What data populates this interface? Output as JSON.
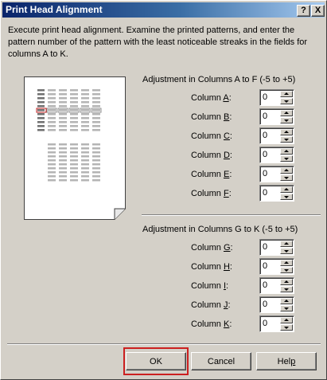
{
  "window": {
    "title": "Print Head Alignment",
    "help_glyph": "?",
    "close_glyph": "X"
  },
  "instructions": "Execute print head alignment. Examine the printed patterns, and enter the pattern number of the pattern with the least noticeable streaks in the fields for columns A to K.",
  "groups": [
    {
      "label": "Adjustment in Columns A to F (-5 to +5)",
      "rows": [
        {
          "prefix": "Column ",
          "key": "A",
          "suffix": ":",
          "value": "0"
        },
        {
          "prefix": "Column ",
          "key": "B",
          "suffix": ":",
          "value": "0"
        },
        {
          "prefix": "Column ",
          "key": "C",
          "suffix": ":",
          "value": "0"
        },
        {
          "prefix": "Column ",
          "key": "D",
          "suffix": ":",
          "value": "0"
        },
        {
          "prefix": "Column ",
          "key": "E",
          "suffix": ":",
          "value": "0"
        },
        {
          "prefix": "Column ",
          "key": "F",
          "suffix": ":",
          "value": "0"
        }
      ]
    },
    {
      "label": "Adjustment in Columns G to K (-5 to +5)",
      "rows": [
        {
          "prefix": "Column ",
          "key": "G",
          "suffix": ":",
          "value": "0"
        },
        {
          "prefix": "Column ",
          "key": "H",
          "suffix": ":",
          "value": "0"
        },
        {
          "prefix": "Column ",
          "key": "I",
          "suffix": ":",
          "value": "0"
        },
        {
          "prefix": "Column ",
          "key": "J",
          "suffix": ":",
          "value": "0"
        },
        {
          "prefix": "Column ",
          "key": "K",
          "suffix": ":",
          "value": "0"
        }
      ]
    }
  ],
  "buttons": {
    "ok": {
      "label": "OK"
    },
    "cancel": {
      "label": "Cancel"
    },
    "help": {
      "prefix": "Hel",
      "key": "p",
      "suffix": ""
    }
  },
  "colors": {
    "titlebar_start": "#0a246a",
    "titlebar_end": "#a6caf0",
    "face": "#d4d0c8",
    "highlight_outline": "#cc2020"
  }
}
